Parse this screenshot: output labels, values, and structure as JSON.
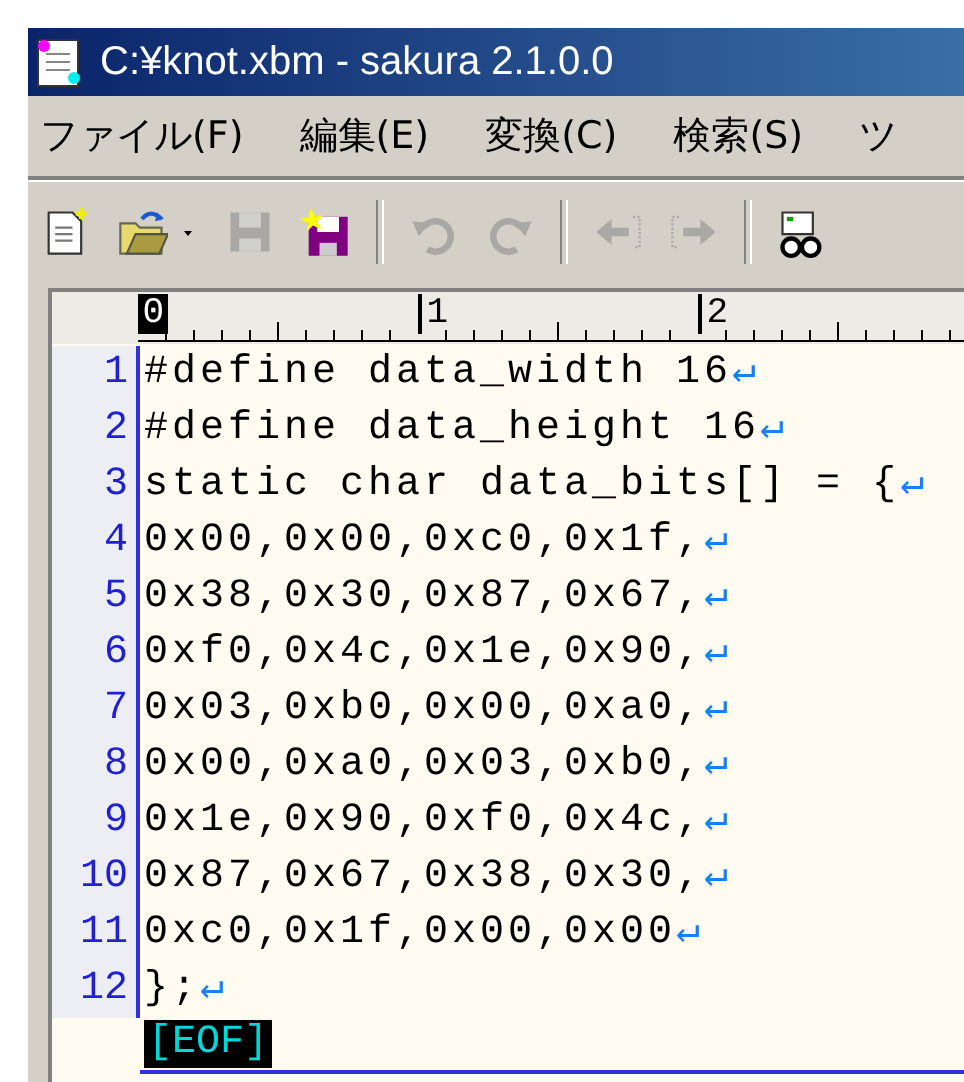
{
  "window": {
    "title": "C:¥knot.xbm - sakura 2.1.0.0"
  },
  "menu": [
    {
      "label": "ファイル(F)"
    },
    {
      "label": "編集(E)"
    },
    {
      "label": "変換(C)"
    },
    {
      "label": "検索(S)"
    },
    {
      "label": "ツ"
    }
  ],
  "toolbar": [
    {
      "kind": "new",
      "disabled": false
    },
    {
      "kind": "open",
      "disabled": false
    },
    {
      "kind": "dropdown",
      "disabled": false
    },
    {
      "kind": "save",
      "disabled": true
    },
    {
      "kind": "saveall",
      "disabled": false
    },
    {
      "kind": "sep"
    },
    {
      "kind": "undo",
      "disabled": true
    },
    {
      "kind": "redo",
      "disabled": true
    },
    {
      "kind": "sep"
    },
    {
      "kind": "back",
      "disabled": true
    },
    {
      "kind": "forward",
      "disabled": true
    },
    {
      "kind": "sep"
    },
    {
      "kind": "find",
      "disabled": false
    }
  ],
  "ruler": {
    "labels": [
      "0",
      "1",
      "2"
    ]
  },
  "lines": [
    {
      "number": "1",
      "text": "#define data_width 16",
      "eol": "↵"
    },
    {
      "number": "2",
      "text": "#define data_height 16",
      "eol": "↵"
    },
    {
      "number": "3",
      "text": "static char data_bits[] = {",
      "eol": "↵"
    },
    {
      "number": "4",
      "text": "0x00,0x00,0xc0,0x1f,",
      "eol": "↵"
    },
    {
      "number": "5",
      "text": "0x38,0x30,0x87,0x67,",
      "eol": "↵"
    },
    {
      "number": "6",
      "text": "0xf0,0x4c,0x1e,0x90,",
      "eol": "↵"
    },
    {
      "number": "7",
      "text": "0x03,0xb0,0x00,0xa0,",
      "eol": "↵"
    },
    {
      "number": "8",
      "text": "0x00,0xa0,0x03,0xb0,",
      "eol": "↵"
    },
    {
      "number": "9",
      "text": "0x1e,0x90,0xf0,0x4c,",
      "eol": "↵"
    },
    {
      "number": "10",
      "text": "0x87,0x67,0x38,0x30,",
      "eol": "↵"
    },
    {
      "number": "11",
      "text": "0xc0,0x1f,0x00,0x00",
      "eol": "↵"
    },
    {
      "number": "12",
      "text": "};",
      "eol": "↵"
    }
  ],
  "eof": "[EOF]"
}
